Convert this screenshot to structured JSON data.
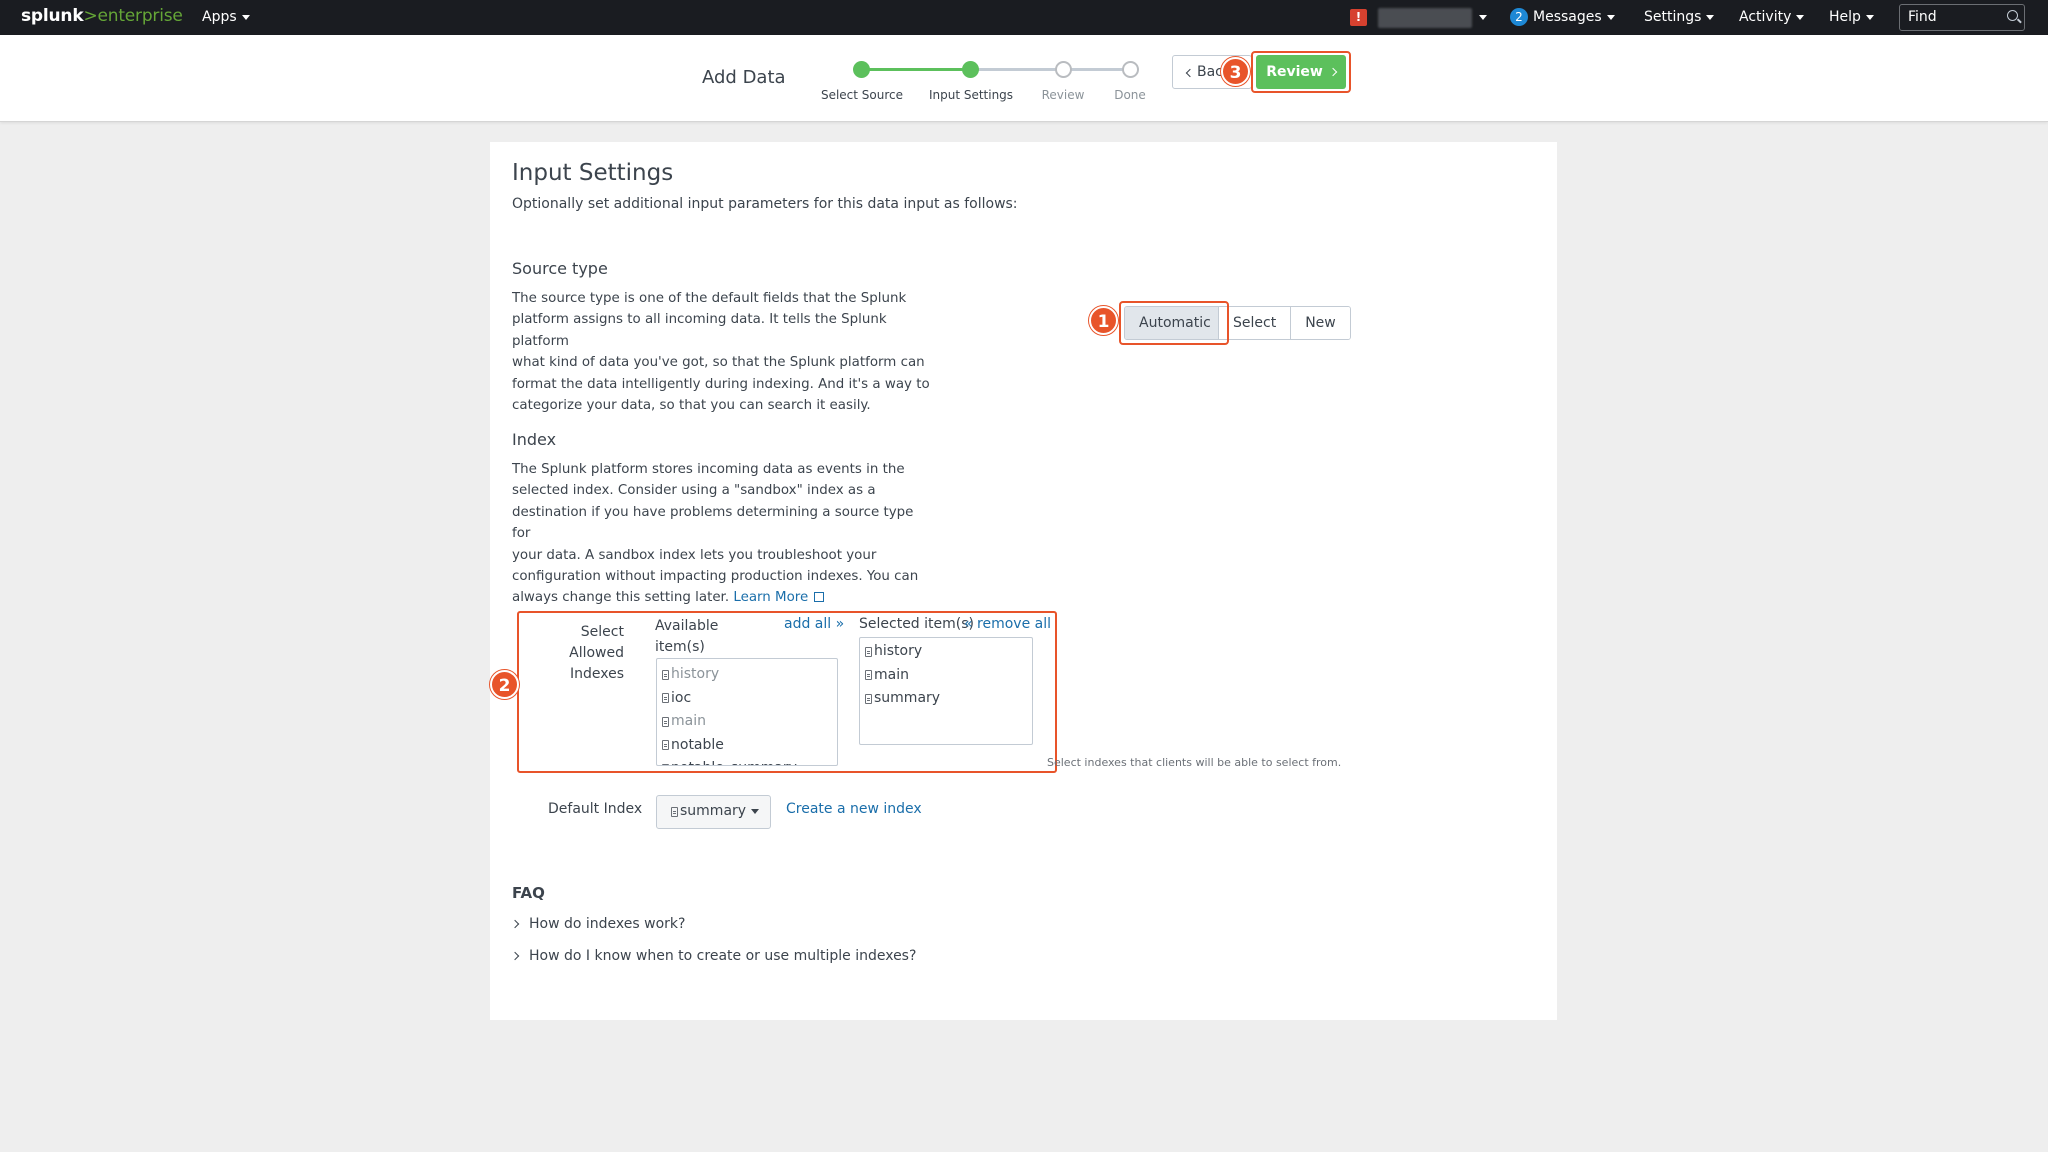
{
  "topbar": {
    "logo_brand": "splunk",
    "logo_separator": ">",
    "logo_product": "enterprise",
    "apps": "Apps",
    "messages_count": "2",
    "messages": "Messages",
    "settings": "Settings",
    "activity": "Activity",
    "help": "Help",
    "find_placeholder": "Find",
    "alert_glyph": "!"
  },
  "header": {
    "title": "Add Data",
    "steps": [
      {
        "label": "Select Source",
        "state": "done"
      },
      {
        "label": "Input Settings",
        "state": "done"
      },
      {
        "label": "Review",
        "state": "todo"
      },
      {
        "label": "Done",
        "state": "todo"
      }
    ],
    "back_label": "Bac",
    "review_label": "Review"
  },
  "markers": {
    "one": "1",
    "two": "2",
    "three": "3"
  },
  "main": {
    "title": "Input Settings",
    "subtitle": "Optionally set additional input parameters for this data input as follows:",
    "source_type": {
      "heading": "Source type",
      "description_lines": [
        "The source type is one of the default fields that the Splunk",
        "platform assigns to all incoming data. It tells the Splunk platform",
        "what kind of data you've got, so that the Splunk platform can",
        "format the data intelligently during indexing. And it's a way to",
        "categorize your data, so that you can search it easily."
      ],
      "options": [
        "Automatic",
        "Select",
        "New"
      ],
      "selected": "Automatic"
    },
    "index": {
      "heading": "Index",
      "description_lines": [
        "The Splunk platform stores incoming data as events in the",
        "selected index. Consider using a \"sandbox\" index as a",
        "destination if you have problems determining a source type for",
        "your data. A sandbox index lets you troubleshoot your",
        "configuration without impacting production indexes. You can",
        "always change this setting later."
      ],
      "learn_more": "Learn More",
      "allowed_label_line1": "Select Allowed",
      "allowed_label_line2": "Indexes",
      "available_label_line1": "Available",
      "available_label_line2": "item(s)",
      "add_all": "add all »",
      "selected_label": "Selected item(s)",
      "remove_all": "« remove all",
      "available_items": [
        {
          "name": "history",
          "dim": true
        },
        {
          "name": "ioc",
          "dim": false
        },
        {
          "name": "main",
          "dim": true
        },
        {
          "name": "notable",
          "dim": false
        },
        {
          "name": "notable_summary",
          "dim": false
        }
      ],
      "selected_items": [
        "history",
        "main",
        "summary"
      ],
      "hint": "Select indexes that clients will be able to select from.",
      "default_index_label": "Default Index",
      "default_index_value": "summary",
      "create_index": "Create a new index"
    },
    "faq": {
      "heading": "FAQ",
      "items": [
        "How do indexes work?",
        "How do I know when to create or use multiple indexes?"
      ]
    }
  },
  "colors": {
    "accent_green": "#5cc05c",
    "highlight": "#e8542a",
    "link": "#1a6eaa",
    "topbar": "#1a1c21"
  }
}
